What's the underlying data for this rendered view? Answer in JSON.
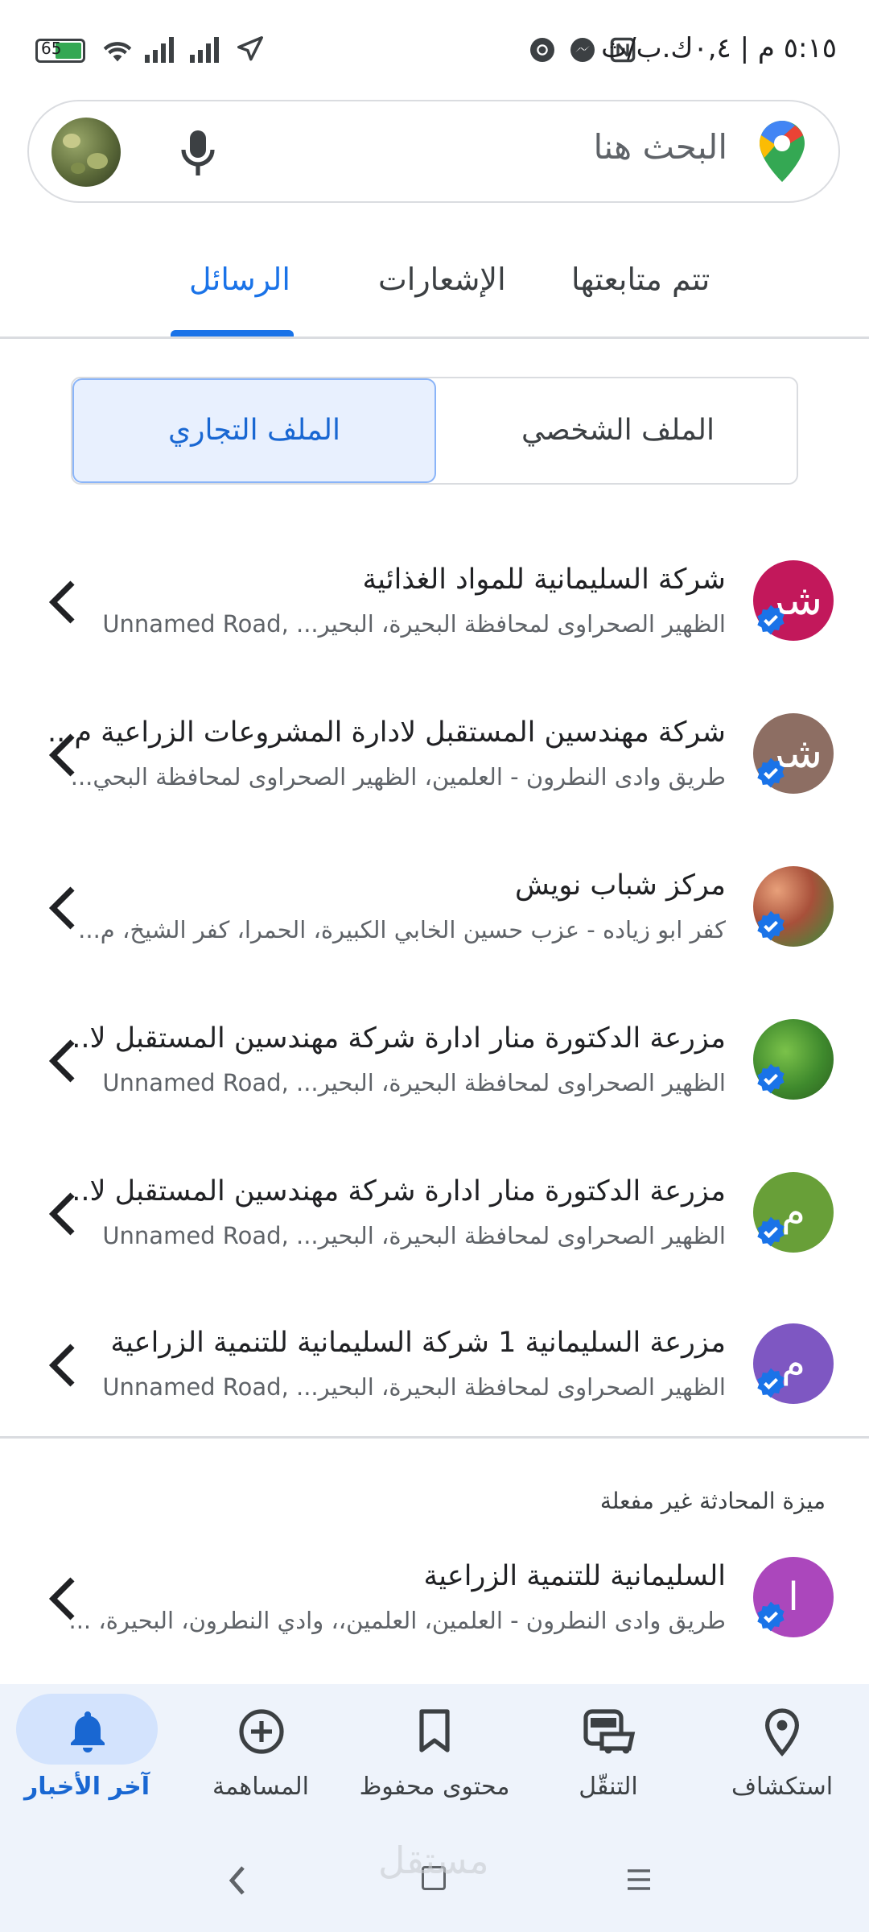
{
  "status_bar": {
    "time": "٥:١٥ م | ٠,٤ك.ب/ث",
    "battery": "65"
  },
  "search": {
    "placeholder": "البحث هنا"
  },
  "tabs": [
    {
      "label": "تتم متابعتها"
    },
    {
      "label": "الإشعارات"
    },
    {
      "label": "الرسائل",
      "active": true
    }
  ],
  "profile_toggle": {
    "personal": "الملف الشخصي",
    "business": "الملف التجاري",
    "selected": "business"
  },
  "conversations": [
    {
      "avatar_text": "شر",
      "avatar_color": "#c2185b",
      "title": "شركة السليمانية للمواد الغذائية",
      "subtitle": "الظهير الصحراوى لمحافظة البحيرة، البحير... ,Unnamed Road"
    },
    {
      "avatar_text": "شر",
      "avatar_color": "#8d6e63",
      "title": "شركة مهندسين المستقبل لادارة المشروعات الزراعية م...",
      "subtitle": "طريق وادى النطرون - العلمين، الظهير الصحراوى لمحافظة البحي..."
    },
    {
      "avatar_text": "",
      "avatar_color": "#8a5a3c",
      "title": "مركز شباب نويش",
      "subtitle": "كفر ابو زياده - عزب حسين الخابي الكبيرة، الحمرا، كفر الشيخ، م..."
    },
    {
      "avatar_text": "",
      "avatar_color": "#3f8a2d",
      "title": "مزرعة الدكتورة منار ادارة شركة مهندسين المستقبل لا...",
      "subtitle": "الظهير الصحراوى لمحافظة البحيرة، البحير... ,Unnamed Road"
    },
    {
      "avatar_text": "م",
      "avatar_color": "#689f38",
      "title": "مزرعة الدكتورة منار ادارة شركة مهندسين المستقبل لا...",
      "subtitle": "الظهير الصحراوى لمحافظة البحيرة، البحير... ,Unnamed Road"
    },
    {
      "avatar_text": "م",
      "avatar_color": "#7e57c2",
      "title": "مزرعة السليمانية 1 شركة السليمانية للتنمية الزراعية",
      "subtitle": "الظهير الصحراوى لمحافظة البحيرة، البحير... ,Unnamed Road"
    }
  ],
  "section_label": "ميزة المحادثة غير مفعلة",
  "disabled_conversations": [
    {
      "avatar_text": "ا",
      "avatar_color": "#ab47bc",
      "title": "السليمانية للتنمية الزراعية",
      "subtitle": "طريق وادى النطرون - العلمين، العلمين،، وادي النطرون، البحيرة، ..."
    }
  ],
  "bottom_nav": [
    {
      "label": "استكشاف",
      "icon": "location-pin-icon"
    },
    {
      "label": "التنقّل",
      "icon": "commute-icon"
    },
    {
      "label": "محتوى محفوظ",
      "icon": "bookmark-icon"
    },
    {
      "label": "المساهمة",
      "icon": "add-circle-icon"
    },
    {
      "label": "آخر الأخبار",
      "icon": "bell-icon",
      "active": true
    }
  ],
  "watermark": "مستقل"
}
